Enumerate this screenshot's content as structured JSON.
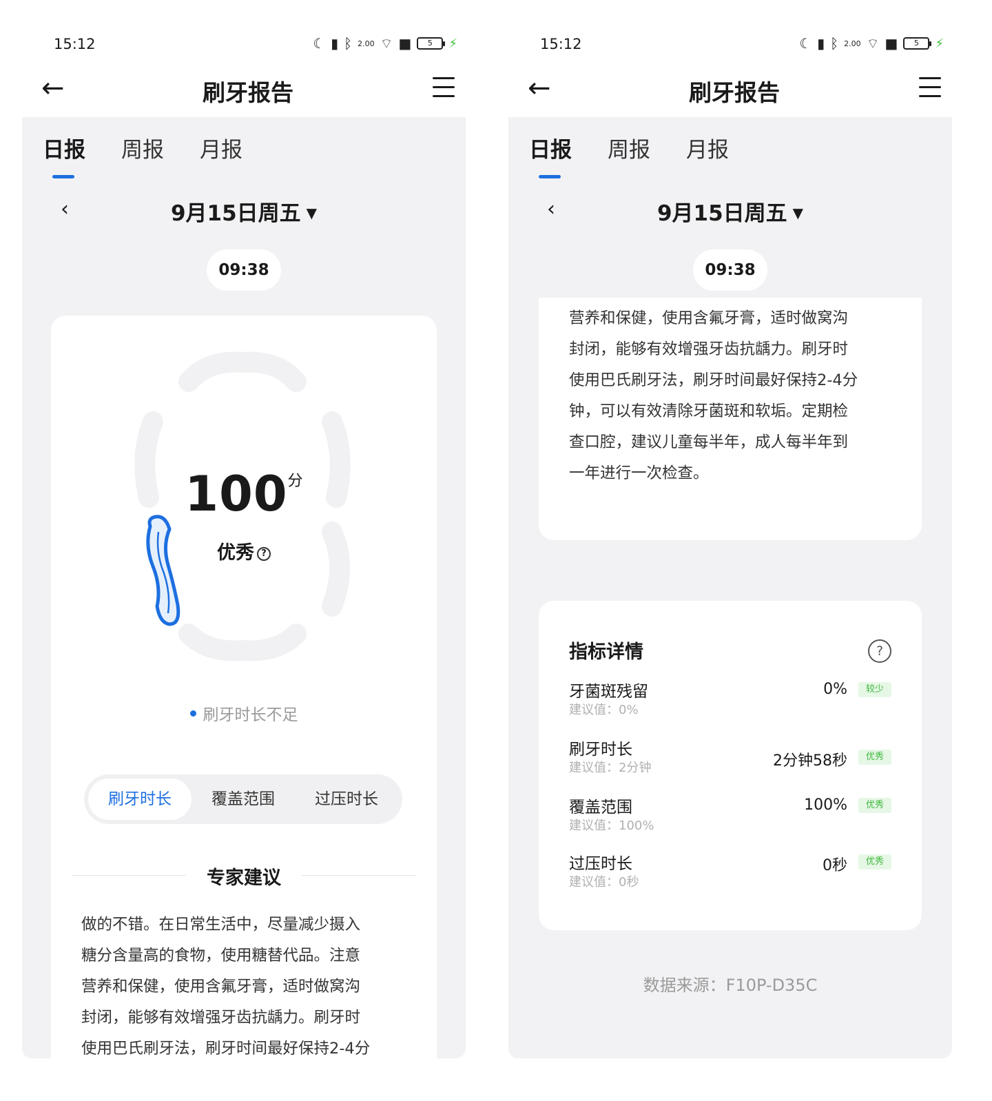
{
  "status_bar": {
    "time": "15:12",
    "net_speed": "2.00",
    "battery_level": "5"
  },
  "header": {
    "title": "刷牙报告"
  },
  "tabs": [
    {
      "label": "日报",
      "active": true
    },
    {
      "label": "周报",
      "active": false
    },
    {
      "label": "月报",
      "active": false
    }
  ],
  "date": {
    "label": "9月15日周五"
  },
  "session_time": "09:38",
  "score": {
    "value": "100",
    "unit": "分",
    "grade": "优秀"
  },
  "hint": "刷牙时长不足",
  "segments": [
    {
      "label": "刷牙时长",
      "active": true
    },
    {
      "label": "覆盖范围",
      "active": false
    },
    {
      "label": "过压时长",
      "active": false
    }
  ],
  "advice": {
    "title": "专家建议",
    "left_lines": [
      "做的不错。在日常生活中，尽量减少摄入",
      "糖分含量高的食物，使用糖替代品。注意",
      "营养和保健，使用含氟牙膏，适时做窝沟",
      "封闭，能够有效增强牙齿抗龋力。刷牙时",
      "使用巴氏刷牙法，刷牙时间最好保持2-4分"
    ],
    "right_lines": [
      "营养和保健，使用含氟牙膏，适时做窝沟",
      "封闭，能够有效增强牙齿抗龋力。刷牙时",
      "使用巴氏刷牙法，刷牙时间最好保持2-4分",
      "钟，可以有效清除牙菌斑和软垢。定期检",
      "查口腔，建议儿童每半年，成人每半年到",
      "一年进行一次检查。"
    ]
  },
  "metrics": {
    "title": "指标详情",
    "items": [
      {
        "name": "牙菌斑残留",
        "suggest": "建议值：0%",
        "value": "0%",
        "badge": "较少"
      },
      {
        "name": "刷牙时长",
        "suggest": "建议值：2分钟",
        "value": "2分钟58秒",
        "badge": "优秀"
      },
      {
        "name": "覆盖范围",
        "suggest": "建议值：100%",
        "value": "100%",
        "badge": "优秀"
      },
      {
        "name": "过压时长",
        "suggest": "建议值：0秒",
        "value": "0秒",
        "badge": "优秀"
      }
    ]
  },
  "source": "数据来源：F10P-D35C",
  "icons": {
    "back": "arrow-left-icon",
    "menu": "menu-icon",
    "prev_date": "chevron-left-icon",
    "dropdown": "triangle-down-icon",
    "help": "question-circle-icon"
  },
  "colors": {
    "accent": "#1d6fe0",
    "badge_green": "#3cb83c",
    "panel_bg": "#f2f2f4"
  }
}
